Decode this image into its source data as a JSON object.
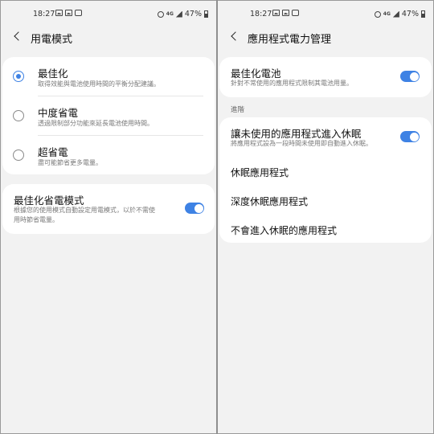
{
  "status": {
    "time": "18:27",
    "battery": "47%"
  },
  "left": {
    "title": "用電模式",
    "options": [
      {
        "label": "最佳化",
        "desc": "取得效能與電池使用時間的平衡分配建議。",
        "selected": true
      },
      {
        "label": "中度省電",
        "desc": "透過限制部分功能來延長電池使用時間。",
        "selected": false
      },
      {
        "label": "超省電",
        "desc": "盡可能節省更多電量。",
        "selected": false
      }
    ],
    "adaptive": {
      "label": "最佳化省電模式",
      "desc_line1": "根據您的使用模式自動設定用電模式，以於不需使",
      "desc_line2": "用時節省電量。",
      "enabled": true
    }
  },
  "right": {
    "title": "應用程式電力管理",
    "optimize": {
      "label": "最佳化電池",
      "desc": "針對不常使用的應用程式限制其電池用量。",
      "enabled": true
    },
    "section_label": "進階",
    "sleep_unused": {
      "label": "讓未使用的應用程式進入休眠",
      "desc": "將應用程式設為一段時間未使用即自動進入休眠。",
      "enabled": true
    },
    "items": [
      "休眠應用程式",
      "深度休眠應用程式",
      "不會進入休眠的應用程式"
    ]
  },
  "colors": {
    "accent": "#3e82e4",
    "background": "#f2f2f2",
    "card": "#ffffff"
  }
}
